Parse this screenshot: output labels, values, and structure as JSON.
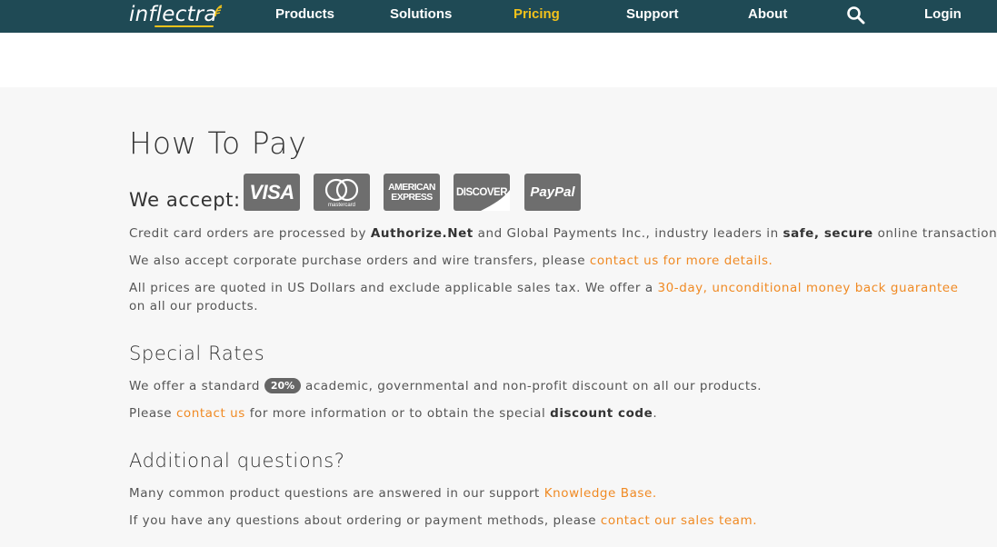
{
  "nav": {
    "logo": "inflectra",
    "items": [
      {
        "label": "Products",
        "active": false
      },
      {
        "label": "Solutions",
        "active": false
      },
      {
        "label": "Pricing",
        "active": true
      },
      {
        "label": "Support",
        "active": false
      },
      {
        "label": "About",
        "active": false
      }
    ],
    "search_icon": "search-icon",
    "login": "Login",
    "accent_color": "#f2c21b",
    "bg_color": "#1f4a55"
  },
  "how_to_pay": {
    "title": "How To Pay",
    "we_accept": "We accept:",
    "cards": {
      "visa": "VISA",
      "mastercard": "mastercard",
      "amex_line1": "AMERICAN",
      "amex_line2": "EXPRESS",
      "discover": "DISCOVER",
      "paypal": "PayPal"
    },
    "p1": {
      "pre": "Credit card orders are processed by ",
      "bold1": "Authorize.Net",
      "mid": " and Global Payments Inc., industry leaders in ",
      "bold2": "safe, secure",
      "post": " online transactions."
    },
    "p2": {
      "pre": "We also accept corporate purchase orders and wire transfers, please ",
      "link": "contact us for more details."
    },
    "p3": {
      "pre": "All prices are quoted in US Dollars and exclude applicable sales tax. We offer a ",
      "link": "30-day, unconditional money back guarantee",
      "post": " on all our products."
    }
  },
  "special_rates": {
    "title": "Special Rates",
    "p1": {
      "pre": "We offer a standard ",
      "badge": "20%",
      "post": " academic, governmental and non-profit discount on all our products."
    },
    "p2": {
      "pre": "Please ",
      "link": "contact us",
      "mid": " for more information or to obtain the special ",
      "bold": "discount code",
      "post": "."
    }
  },
  "additional": {
    "title": "Additional questions?",
    "p1": {
      "pre": "Many common product questions are answered in our support ",
      "link": "Knowledge Base."
    },
    "p2": {
      "pre": "If you have any questions about ordering or payment methods, please ",
      "link": "contact our sales team."
    }
  },
  "colors": {
    "link": "#f08a24",
    "card_bg": "#6e6e6e",
    "page_bg": "#f7f7f7"
  }
}
